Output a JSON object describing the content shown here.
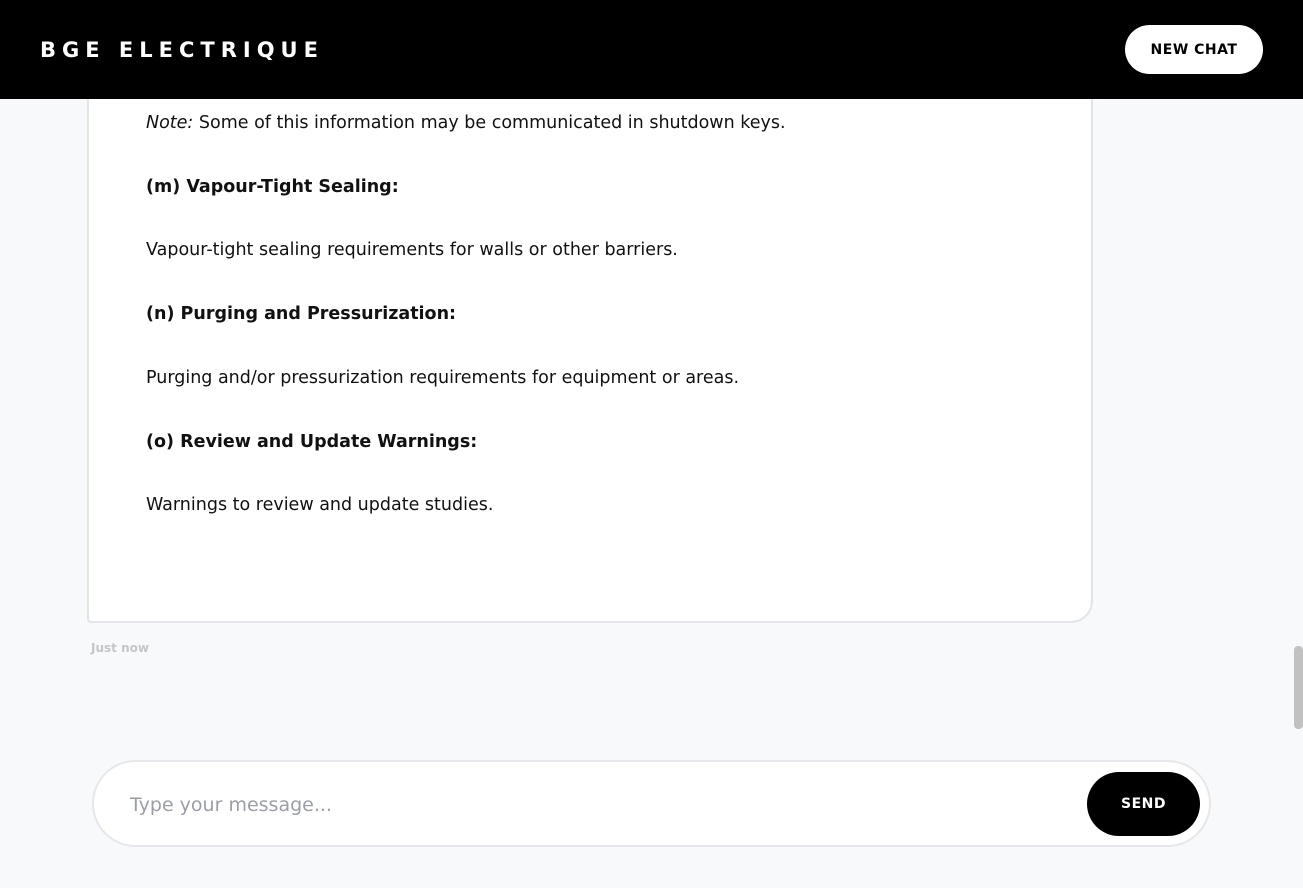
{
  "header": {
    "brand": "BGE ELECTRIQUE",
    "new_chat_label": "NEW CHAT"
  },
  "message": {
    "note_label": "Note:",
    "note_text": " Some of this information may be communicated in shutdown keys.",
    "sections": [
      {
        "heading": "(m) Vapour-Tight Sealing:",
        "body": "Vapour-tight sealing requirements for walls or other barriers."
      },
      {
        "heading": "(n) Purging and Pressurization:",
        "body": "Purging and/or pressurization requirements for equipment or areas."
      },
      {
        "heading": "(o) Review and Update Warnings:",
        "body": "Warnings to review and update studies."
      }
    ],
    "timestamp": "Just now"
  },
  "composer": {
    "placeholder": "Type your message...",
    "value": "",
    "send_label": "SEND"
  },
  "colors": {
    "header_bg": "#000000",
    "page_bg": "#f8f9fa",
    "send_bg": "#000000"
  }
}
